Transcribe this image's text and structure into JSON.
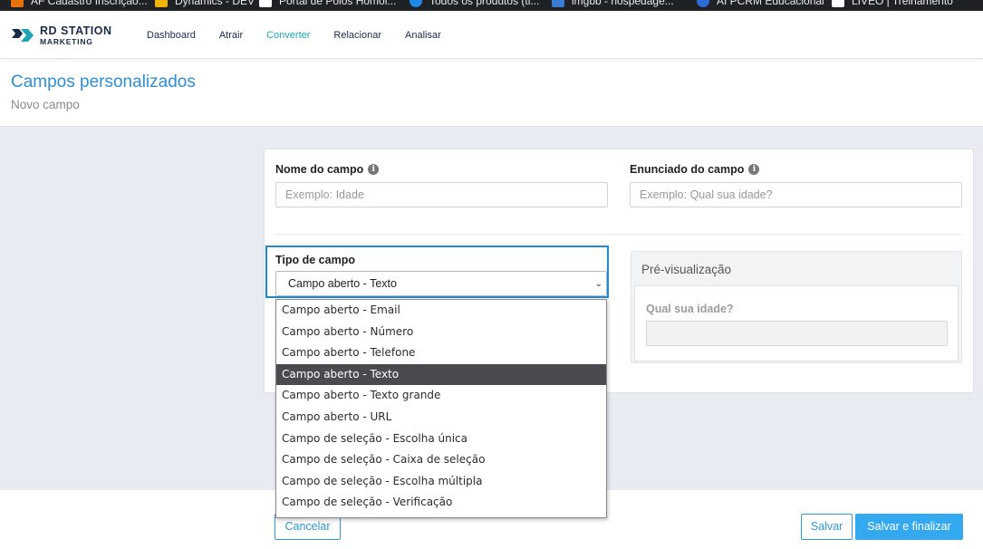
{
  "bookmarks": [
    {
      "label": "AF Cadastro Inscrição...",
      "icon": "orange-square-icon",
      "color": "#e8710a"
    },
    {
      "label": "Dynamics - DEV",
      "icon": "windows-icon",
      "color": "#f2b400"
    },
    {
      "label": "Portal de Polos Homol...",
      "icon": "page-icon",
      "color": "#ffffff"
    },
    {
      "label": "Todos os produtos (ti...",
      "icon": "cloud-icon",
      "color": "#1e88e5"
    },
    {
      "label": "imgbb - hospedage...",
      "icon": "imgbb-icon",
      "color": "#3a7bd5"
    },
    {
      "label": "AI  PCRM Educacional",
      "icon": "person-icon",
      "color": "#2f6bd8"
    },
    {
      "label": "LIVEO | Treinamento",
      "icon": "page-icon",
      "color": "#ffffff"
    }
  ],
  "brand": {
    "line1": "RD STATION",
    "line2": "MARKETING"
  },
  "nav": [
    {
      "label": "Dashboard",
      "active": false
    },
    {
      "label": "Atrair",
      "active": false
    },
    {
      "label": "Converter",
      "active": true
    },
    {
      "label": "Relacionar",
      "active": false
    },
    {
      "label": "Analisar",
      "active": false
    }
  ],
  "page": {
    "title": "Campos personalizados",
    "subtitle": "Novo campo"
  },
  "form": {
    "name_label": "Nome do campo",
    "name_placeholder": "Exemplo: Idade",
    "statement_label": "Enunciado do campo",
    "statement_placeholder": "Exemplo: Qual sua idade?",
    "type_label": "Tipo de campo",
    "type_value": "Campo aberto - Texto",
    "type_options": [
      "Campo aberto - Email",
      "Campo aberto - Número",
      "Campo aberto - Telefone",
      "Campo aberto - Texto",
      "Campo aberto - Texto grande",
      "Campo aberto - URL",
      "Campo de seleção - Escolha única",
      "Campo de seleção - Caixa de seleção",
      "Campo de seleção - Escolha múltipla",
      "Campo de seleção - Verificação"
    ],
    "selected_index": 3
  },
  "preview": {
    "title": "Pré-visualização",
    "question": "Qual sua idade?"
  },
  "footer": {
    "cancel": "Cancelar",
    "save": "Salvar",
    "save_finish": "Salvar e finalizar"
  },
  "colors": {
    "accent": "#2e9ad8",
    "nav_active": "#20a3b3",
    "primary_button": "#35a9f0"
  }
}
